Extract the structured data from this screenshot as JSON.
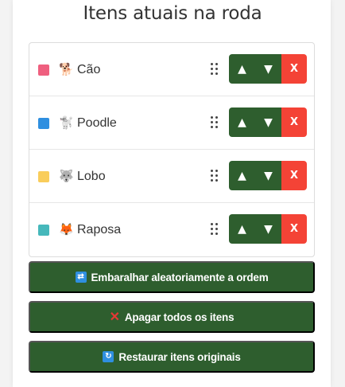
{
  "title": "Itens atuais na roda",
  "items": [
    {
      "emoji": "🐕",
      "label": "Cão",
      "color": "#ef5f7f"
    },
    {
      "emoji": "🐩",
      "label": "Poodle",
      "color": "#2f8fe0"
    },
    {
      "emoji": "🐺",
      "label": "Lobo",
      "color": "#f9cd5b"
    },
    {
      "emoji": "🦊",
      "label": "Raposa",
      "color": "#46b8bb"
    }
  ],
  "controls": {
    "up": "▲",
    "down": "▼",
    "delete": "X"
  },
  "actions": {
    "shuffle": {
      "icon": "🔀",
      "label": "Embaralhar aleatoriamente a ordem"
    },
    "clear": {
      "icon": "❌",
      "label": "Apagar todos os itens"
    },
    "restore": {
      "icon": "🔄",
      "label": "Restaurar itens originais"
    }
  },
  "colors": {
    "primary": "#2e5e2e",
    "danger": "#f44336"
  }
}
